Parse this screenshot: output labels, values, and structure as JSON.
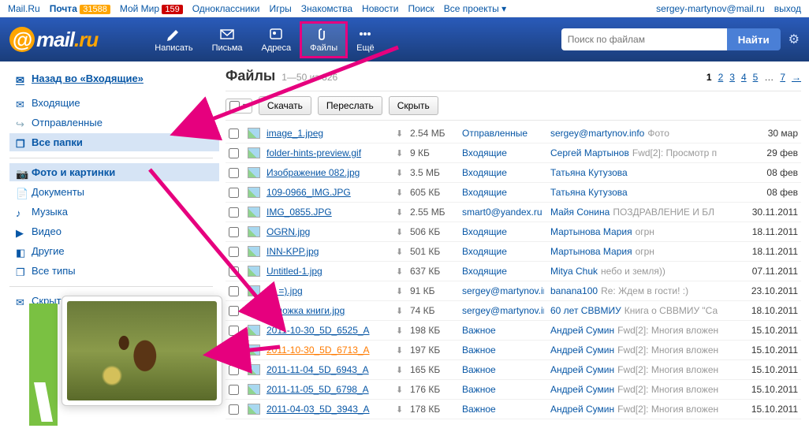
{
  "topnav": {
    "items": [
      "Mail.Ru",
      "Почта",
      "Мой Мир",
      "Одноклассники",
      "Игры",
      "Знакомства",
      "Новости",
      "Поиск",
      "Все проекты"
    ],
    "badge1": "31588",
    "badge2": "159",
    "user": "sergey-martynov@mail.ru",
    "logout": "выход"
  },
  "logo": {
    "pre": "mail",
    "suf": ".ru"
  },
  "nav": {
    "write": "Написать",
    "mail": "Письма",
    "contacts": "Адреса",
    "files": "Файлы",
    "more": "Ещё"
  },
  "search": {
    "placeholder": "Поиск по файлам",
    "btn": "Найти"
  },
  "sidebar": {
    "back": "Назад во «Входящие»",
    "inbox": "Входящие",
    "sent": "Отправленные",
    "all": "Все папки",
    "photos": "Фото и картинки",
    "docs": "Документы",
    "music": "Музыка",
    "video": "Видео",
    "other": "Другие",
    "alltypes": "Все типы",
    "hidden": "Скрытые"
  },
  "heading": {
    "title": "Файлы",
    "range": "1—50 из 326"
  },
  "pager": {
    "pages": [
      "1",
      "2",
      "3",
      "4",
      "5"
    ],
    "dots": "…",
    "last": "7",
    "arrow": "→"
  },
  "toolbar": {
    "download": "Скачать",
    "forward": "Переслать",
    "hide": "Скрыть"
  },
  "files": [
    {
      "name": "image_1.jpeg",
      "size": "2.54 МБ",
      "folder": "Отправленные",
      "sender": "sergey@martynov.info",
      "subj": "Фото",
      "date": "30 мар"
    },
    {
      "name": "folder-hints-preview.gif",
      "size": "9 КБ",
      "folder": "Входящие",
      "sender": "Сергей Мартынов",
      "subj": "Fwd[2]: Просмотр п",
      "date": "29 фев"
    },
    {
      "name": "Изображение 082.jpg",
      "size": "3.5 МБ",
      "folder": "Входящие",
      "sender": "Татьяна Кутузова",
      "subj": "",
      "date": "08 фев"
    },
    {
      "name": "109-0966_IMG.JPG",
      "size": "605 КБ",
      "folder": "Входящие",
      "sender": "Татьяна Кутузова",
      "subj": "",
      "date": "08 фев"
    },
    {
      "name": "IMG_0855.JPG",
      "size": "2.55 МБ",
      "folder": "smart0@yandex.ru",
      "sender": "Майя Сонина",
      "subj": "ПОЗДРАВЛЕНИЕ И БЛ",
      "date": "30.11.2011"
    },
    {
      "name": "OGRN.jpg",
      "size": "506 КБ",
      "folder": "Входящие",
      "sender": "Мартынова Мария",
      "subj": "огрн",
      "date": "18.11.2011"
    },
    {
      "name": "INN-KPP.jpg",
      "size": "501 КБ",
      "folder": "Входящие",
      "sender": "Мартынова Мария",
      "subj": "огрн",
      "date": "18.11.2011"
    },
    {
      "name": "Untitled-1.jpg",
      "size": "637 КБ",
      "folder": "Входящие",
      "sender": "Mitya Chuk",
      "subj": "небо и земля))",
      "date": "07.11.2011"
    },
    {
      "name": "lol =).jpg",
      "size": "91 КБ",
      "folder": "sergey@martynov.in",
      "sender": "banana100",
      "subj": "Re: Ждем в гости! :)",
      "date": "23.10.2011"
    },
    {
      "name": "обложка книги.jpg",
      "size": "74 КБ",
      "folder": "sergey@martynov.in",
      "sender": "60 лет СВВМИУ",
      "subj": "Книга о СВВМИУ \"Са",
      "date": "18.10.2011"
    },
    {
      "name": "2011-10-30_5D_6525_A",
      "size": "198 КБ",
      "folder": "Важное",
      "sender": "Андрей Сумин",
      "subj": "Fwd[2]: Многия вложен",
      "date": "15.10.2011"
    },
    {
      "name": "2011-10-30_5D_6713_A",
      "size": "197 КБ",
      "folder": "Важное",
      "sender": "Андрей Сумин",
      "subj": "Fwd[2]: Многия вложен",
      "date": "15.10.2011",
      "hot": true
    },
    {
      "name": "2011-11-04_5D_6943_A",
      "size": "165 КБ",
      "folder": "Важное",
      "sender": "Андрей Сумин",
      "subj": "Fwd[2]: Многия вложен",
      "date": "15.10.2011"
    },
    {
      "name": "2011-11-05_5D_6798_A",
      "size": "176 КБ",
      "folder": "Важное",
      "sender": "Андрей Сумин",
      "subj": "Fwd[2]: Многия вложен",
      "date": "15.10.2011"
    },
    {
      "name": "2011-04-03_5D_3943_A",
      "size": "178 КБ",
      "folder": "Важное",
      "sender": "Андрей Сумин",
      "subj": "Fwd[2]: Многия вложен",
      "date": "15.10.2011"
    }
  ]
}
